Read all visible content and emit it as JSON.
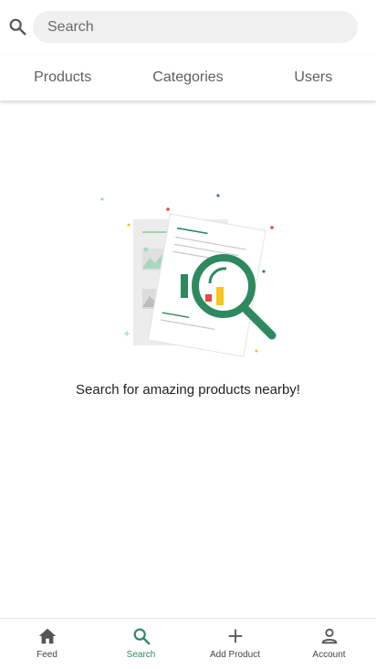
{
  "search": {
    "placeholder": "Search"
  },
  "tabs": [
    {
      "label": "Products"
    },
    {
      "label": "Categories"
    },
    {
      "label": "Users"
    }
  ],
  "empty_state": {
    "message": "Search for amazing products nearby!"
  },
  "bottom_nav": [
    {
      "label": "Feed",
      "icon": "home-icon"
    },
    {
      "label": "Search",
      "icon": "search-icon",
      "active": true
    },
    {
      "label": "Add Product",
      "icon": "plus-icon"
    },
    {
      "label": "Account",
      "icon": "person-icon"
    }
  ],
  "colors": {
    "accent": "#2e8a5e",
    "tab_text": "#5f5f5f",
    "nav_text": "#444444"
  }
}
